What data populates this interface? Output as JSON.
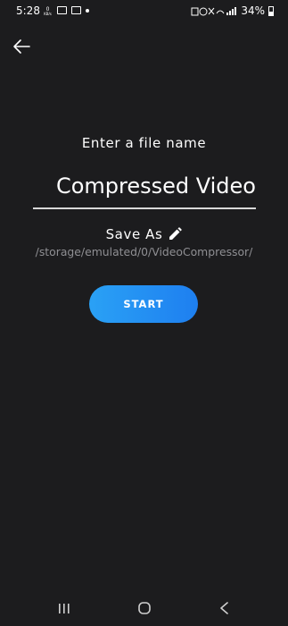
{
  "status_bar": {
    "time": "5:28",
    "battery_percent": "34%",
    "battery_level": 0.34
  },
  "screen": {
    "prompt": "Enter a file name",
    "filename_value": "Compressed Video",
    "save_as_label": "Save As",
    "save_path": "/storage/emulated/0/VideoCompressor/",
    "start_label": "START"
  },
  "colors": {
    "background": "#1c1c1e",
    "accent": "#2196f3",
    "path_text": "#8f8f93"
  },
  "icons": {
    "back": "back-arrow-icon",
    "edit": "pencil-icon",
    "nav_recent": "recent-apps-icon",
    "nav_home": "home-icon",
    "nav_back": "nav-back-icon"
  }
}
